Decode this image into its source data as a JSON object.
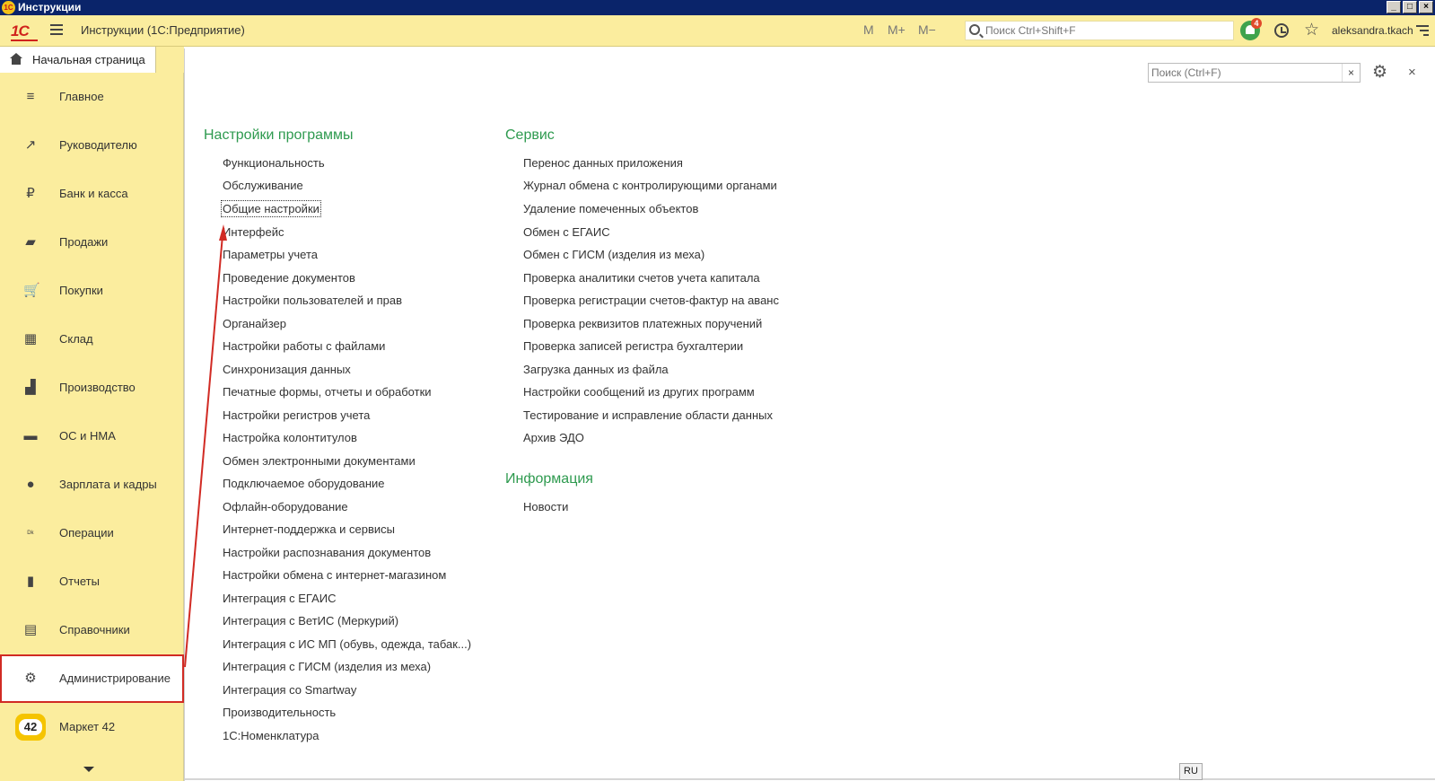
{
  "window": {
    "title": "Инструкции",
    "logo": "1С",
    "buttons": [
      "_",
      "□",
      "×"
    ]
  },
  "appbar": {
    "brand": "1С",
    "title": "Инструкции  (1С:Предприятие)",
    "m_buttons": [
      "M",
      "M+",
      "M−"
    ],
    "search_placeholder": "Поиск Ctrl+Shift+F",
    "notifications_count": "4",
    "user": "aleksandra.tkach"
  },
  "tab": {
    "label": "Начальная страница"
  },
  "sidebar": {
    "items": [
      {
        "label": "Главное",
        "icon": "menu-icon",
        "glyph": "≡"
      },
      {
        "label": "Руководителю",
        "icon": "trend-icon",
        "glyph": "↗"
      },
      {
        "label": "Банк и касса",
        "icon": "ruble-icon",
        "glyph": "₽"
      },
      {
        "label": "Продажи",
        "icon": "bag-icon",
        "glyph": "▰"
      },
      {
        "label": "Покупки",
        "icon": "cart-icon",
        "glyph": "🛒"
      },
      {
        "label": "Склад",
        "icon": "grid-icon",
        "glyph": "▦"
      },
      {
        "label": "Производство",
        "icon": "factory-icon",
        "glyph": "▟"
      },
      {
        "label": "ОС и НМА",
        "icon": "truck-icon",
        "glyph": "▬"
      },
      {
        "label": "Зарплата и кадры",
        "icon": "person-icon",
        "glyph": "●"
      },
      {
        "label": "Операции",
        "icon": "dt-kt-icon",
        "glyph": "ᴰᵏ"
      },
      {
        "label": "Отчеты",
        "icon": "bar-chart-icon",
        "glyph": "▮"
      },
      {
        "label": "Справочники",
        "icon": "book-icon",
        "glyph": "▤"
      },
      {
        "label": "Администрирование",
        "icon": "gear-icon",
        "glyph": "⚙"
      }
    ],
    "market": {
      "label": "Маркет 42",
      "badge": "42"
    }
  },
  "form": {
    "search_placeholder": "Поиск (Ctrl+F)",
    "clear": "×",
    "close": "×",
    "gear": "⚙"
  },
  "sections": {
    "settings": {
      "title": "Настройки программы",
      "links": [
        "Функциональность",
        "Обслуживание",
        "Общие настройки",
        "Интерфейс",
        "Параметры учета",
        "Проведение документов",
        "Настройки пользователей и прав",
        "Органайзер",
        "Настройки работы с файлами",
        "Синхронизация данных",
        "Печатные формы, отчеты и обработки",
        "Настройки регистров учета",
        "Настройка колонтитулов",
        "Обмен электронными документами",
        "Подключаемое оборудование",
        "Офлайн-оборудование",
        "Интернет-поддержка и сервисы",
        "Настройки распознавания документов",
        "Настройки обмена с интернет-магазином",
        "Интеграция с ЕГАИС",
        "Интеграция с ВетИС (Меркурий)",
        "Интеграция с ИС МП (обувь, одежда, табак...)",
        "Интеграция с ГИСМ (изделия из меха)",
        "Интеграция со Smartway",
        "Производительность",
        "1С:Номенклатура"
      ]
    },
    "service": {
      "title": "Сервис",
      "links": [
        "Перенос данных приложения",
        "Журнал обмена с контролирующими органами",
        "Удаление помеченных объектов",
        "Обмен с ЕГАИС",
        "Обмен с ГИСМ (изделия из меха)",
        "Проверка аналитики счетов учета капитала",
        "Проверка регистрации счетов-фактур на аванс",
        "Проверка реквизитов платежных поручений",
        "Проверка записей регистра бухгалтерии",
        "Загрузка данных из файла",
        "Настройки сообщений из других программ",
        "Тестирование и исправление области данных",
        "Архив ЭДО"
      ]
    },
    "info": {
      "title": "Информация",
      "links": [
        "Новости"
      ]
    }
  },
  "status": {
    "lang": "RU"
  },
  "colors": {
    "accent": "#2e9a4f",
    "sidebar": "#fbed9e",
    "highlight": "#d12b24"
  }
}
